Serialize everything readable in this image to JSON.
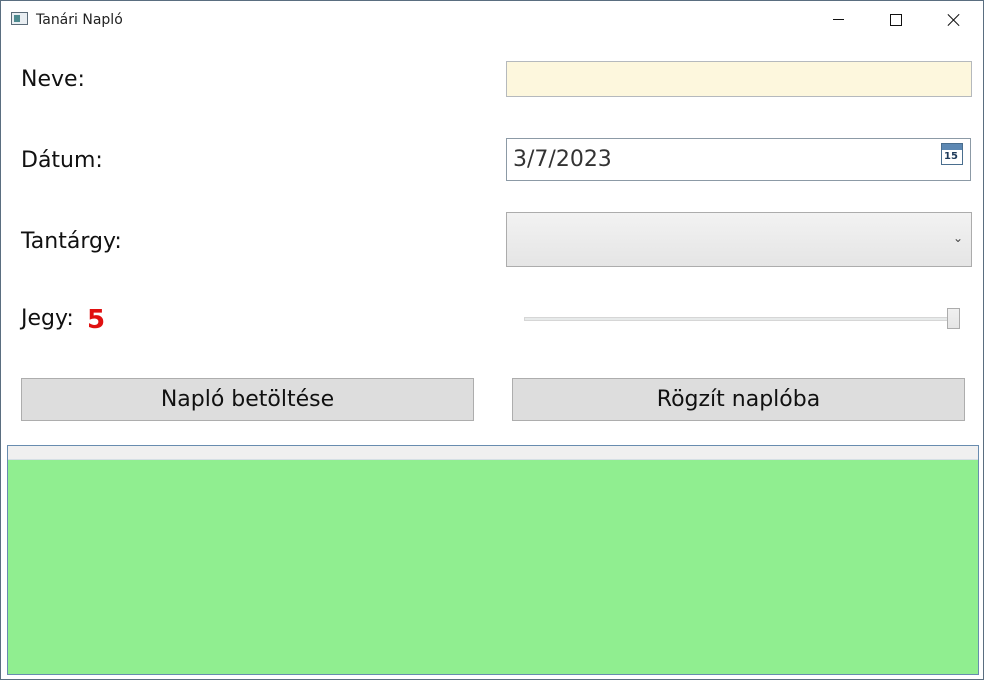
{
  "window": {
    "title": "Tanári Napló"
  },
  "form": {
    "name_label": "Neve:",
    "name_value": "",
    "date_label": "Dátum:",
    "date_value": "3/7/2023",
    "calendar_day": "15",
    "subject_label": "Tantárgy:",
    "subject_value": "",
    "grade_label": "Jegy:",
    "grade_value": "5",
    "grade_slider": {
      "min": 1,
      "max": 5,
      "value": 5
    }
  },
  "buttons": {
    "load_label": "Napló betöltése",
    "save_label": "Rögzít naplóba"
  },
  "colors": {
    "name_field_bg": "#fdf7dd",
    "grade_text": "#e01010",
    "grid_bg": "#90ee90"
  },
  "grid": {
    "rows": []
  }
}
